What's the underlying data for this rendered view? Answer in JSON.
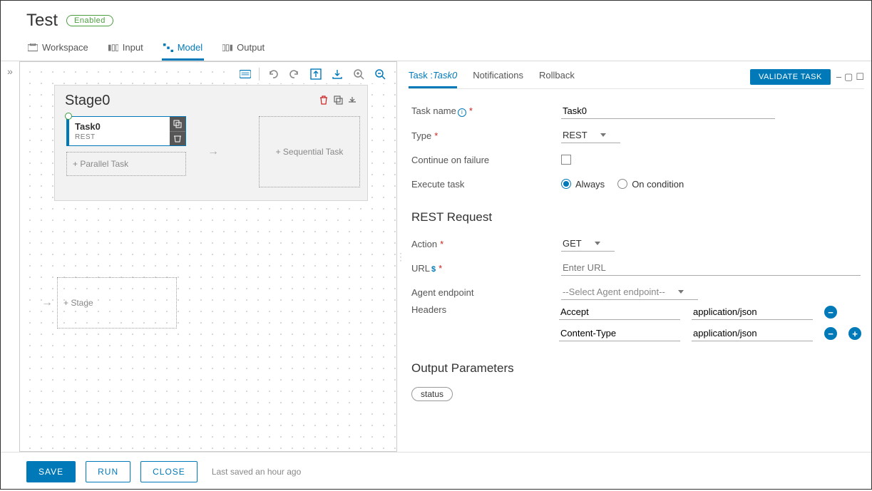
{
  "header": {
    "title": "Test",
    "status": "Enabled"
  },
  "tabs": {
    "workspace": "Workspace",
    "input": "Input",
    "model": "Model",
    "output": "Output"
  },
  "canvas": {
    "stage_title": "Stage0",
    "task": {
      "name": "Task0",
      "type": "REST"
    },
    "parallel": "Parallel Task",
    "sequential": "Sequential Task",
    "add_stage": "Stage"
  },
  "detail": {
    "tabs": {
      "task_prefix": "Task :",
      "task_name": "Task0",
      "notifications": "Notifications",
      "rollback": "Rollback"
    },
    "validate": "VALIDATE TASK",
    "labels": {
      "task_name": "Task name",
      "type": "Type",
      "continue": "Continue on failure",
      "execute": "Execute task",
      "always": "Always",
      "on_condition": "On condition",
      "section_rest": "REST Request",
      "action": "Action",
      "url": "URL",
      "agent": "Agent endpoint",
      "headers": "Headers",
      "section_output": "Output Parameters"
    },
    "values": {
      "task_name": "Task0",
      "type": "REST",
      "action": "GET",
      "url_placeholder": "Enter URL",
      "agent_placeholder": "--Select Agent endpoint--",
      "headers": [
        {
          "key": "Accept",
          "val": "application/json"
        },
        {
          "key": "Content-Type",
          "val": "application/json"
        }
      ],
      "output_param": "status"
    }
  },
  "footer": {
    "save": "SAVE",
    "run": "RUN",
    "close": "CLOSE",
    "saved": "Last saved an hour ago"
  }
}
